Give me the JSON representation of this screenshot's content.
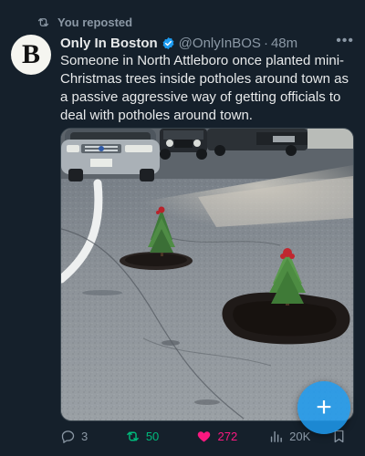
{
  "repost": {
    "text": "You reposted",
    "icon": "repost-icon"
  },
  "author": {
    "avatar_letter": "B",
    "name": "Only In Boston",
    "handle": "@OnlyInBOS",
    "separator": "·",
    "time": "48m",
    "verified": true
  },
  "tweet": {
    "text": "Someone in North Attleboro once planted mini-Christmas trees inside potholes around town as a passive aggressive way of getting officials to deal with potholes around town."
  },
  "actions": {
    "replies": "3",
    "reposts": "50",
    "likes": "272",
    "views": "20K"
  },
  "compose": {
    "icon": "plus-icon",
    "label": "+"
  },
  "colors": {
    "background": "#15202b",
    "text": "#e7e9ea",
    "muted": "#8b98a5",
    "verified": "#1d9bf0",
    "repost_active": "#00ba7c",
    "like_active": "#f91880",
    "fab": "#1d9bf0"
  }
}
